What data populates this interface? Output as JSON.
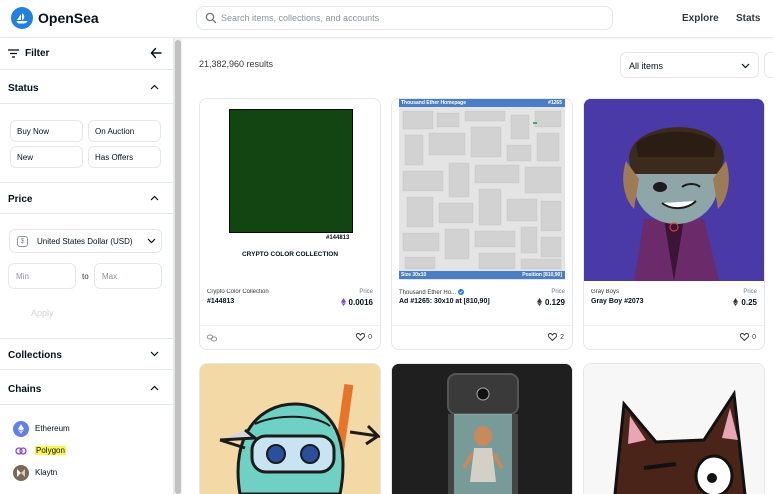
{
  "header": {
    "brand": "OpenSea",
    "search_placeholder": "Search items, collections, and accounts",
    "nav": [
      "Explore",
      "Stats"
    ]
  },
  "sidebar": {
    "filter_label": "Filter",
    "status": {
      "label": "Status",
      "options": [
        "Buy Now",
        "On Auction",
        "New",
        "Has Offers"
      ]
    },
    "price": {
      "label": "Price",
      "currency": "United States Dollar (USD)",
      "min_placeholder": "Min",
      "max_placeholder": "Max",
      "to_label": "to",
      "apply_label": "Apply"
    },
    "collections_label": "Collections",
    "chains": {
      "label": "Chains",
      "items": [
        "Ethereum",
        "Polygon",
        "Klaytn"
      ]
    }
  },
  "main": {
    "results": "21,382,960 results",
    "sort_select": "All items",
    "cards": [
      {
        "image_caption_id": "#144813",
        "image_caption": "CRYPTO COLOR COLLECTION",
        "collection": "Crypto Color Collection",
        "name": "#144813",
        "price_label": "Price",
        "price": "0.0016",
        "price_color": "#8247e5",
        "likes": "0"
      },
      {
        "image_top_label": "Thousand Ether Homepage",
        "image_top_right": "#1265",
        "image_bottom_left": "Size 30x10",
        "image_bottom_right": "Position [810,90]",
        "collection": "Thousand Ether Ho...",
        "name": "Ad #1265: 30x10 at [810,90]",
        "price_label": "Price",
        "price": "0.129",
        "price_color": "#353840",
        "likes": "2"
      },
      {
        "collection": "Gray Boys",
        "name": "Gray Boy #2073",
        "price_label": "Price",
        "price": "0.25",
        "price_color": "#353840",
        "likes": "0"
      }
    ]
  },
  "colors": {
    "brand_blue": "#2081e2",
    "crypto_green": "#124512",
    "gray_boy_bg": "#4a3aa8",
    "skull_bg": "#f3d9a6",
    "skull_color": "#6fd1c4",
    "capsule_bg": "#2c2c2c",
    "highlight": "#fff34d"
  }
}
